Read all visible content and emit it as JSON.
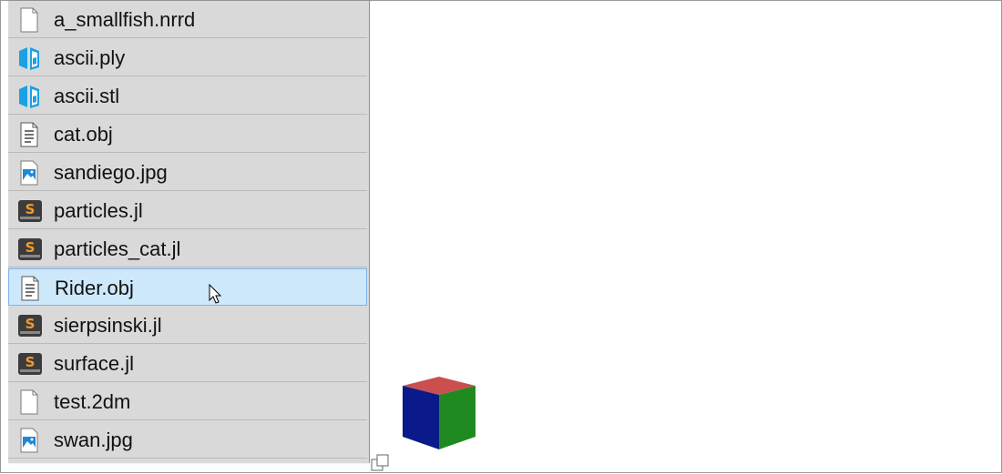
{
  "files": [
    {
      "name": "a_smallfish.nrrd",
      "icon": "blank-file-icon",
      "selected": false
    },
    {
      "name": "ascii.ply",
      "icon": "3d-model-icon",
      "selected": false
    },
    {
      "name": "ascii.stl",
      "icon": "3d-model-icon",
      "selected": false
    },
    {
      "name": "cat.obj",
      "icon": "text-file-icon",
      "selected": false
    },
    {
      "name": "sandiego.jpg",
      "icon": "image-file-icon",
      "selected": false
    },
    {
      "name": "particles.jl",
      "icon": "sublime-file-icon",
      "selected": false
    },
    {
      "name": "particles_cat.jl",
      "icon": "sublime-file-icon",
      "selected": false
    },
    {
      "name": "Rider.obj",
      "icon": "text-file-icon",
      "selected": true
    },
    {
      "name": "sierpsinski.jl",
      "icon": "sublime-file-icon",
      "selected": false
    },
    {
      "name": "surface.jl",
      "icon": "sublime-file-icon",
      "selected": false
    },
    {
      "name": "test.2dm",
      "icon": "blank-file-icon",
      "selected": false
    },
    {
      "name": "swan.jpg",
      "icon": "image-file-icon",
      "selected": false
    }
  ],
  "colors": {
    "list_background": "#d9d9d9",
    "selected_row": "#cde8fb",
    "selected_border": "#7eb4ea",
    "cube_top": "#c9504e",
    "cube_left": "#0a1a8a",
    "cube_right": "#1f8a1f",
    "model_icon_blue": "#1ba1e2"
  },
  "viewport": {
    "preview_icon": "rgb-cube-icon",
    "resize_icon": "resize-handle-icon"
  }
}
